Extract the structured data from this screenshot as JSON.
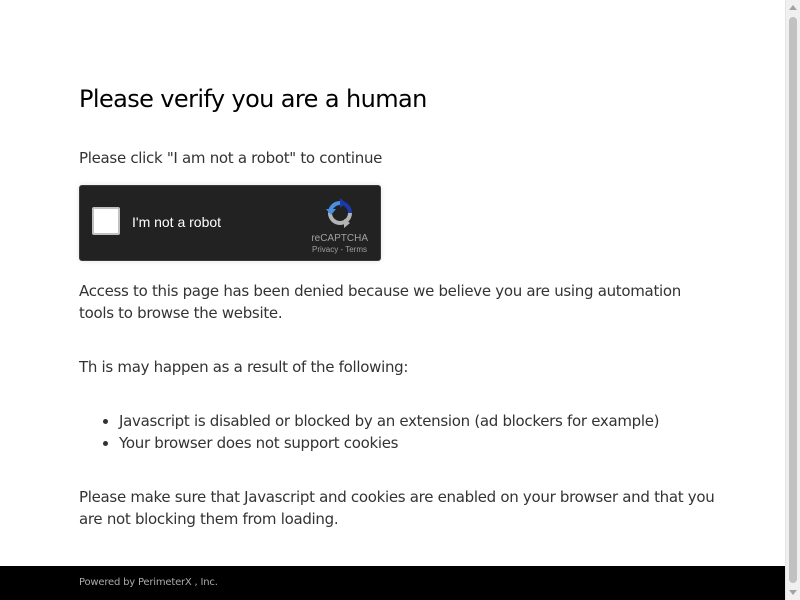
{
  "heading": "Please verify you are a human",
  "instruction": "Please click \"I am not a robot\" to continue",
  "recaptcha": {
    "checkbox_label": "I'm not a robot",
    "brand": "reCAPTCHA",
    "privacy_link": "Privacy",
    "separator": " - ",
    "terms_link": "Terms",
    "icon": "recaptcha-logo-icon",
    "colors": {
      "background": "#222222",
      "logo_blue": "#1c3aa9",
      "logo_light_blue": "#4a90e2",
      "logo_gray": "#b3b3b3"
    }
  },
  "denied_message": "Access to this page has been denied because we believe you are using automation tools to browse the website.",
  "reasons_intro": "Th is may happen as a result of the following:",
  "reasons": [
    "Javascript is disabled or blocked by an extension (ad blockers for example)",
    "Your browser does not support cookies"
  ],
  "final_message": "Please make sure that Javascript and cookies are enabled on your browser and that you are not blocking them from loading.",
  "footer": {
    "powered_by": "Powered by PerimeterX , Inc."
  }
}
